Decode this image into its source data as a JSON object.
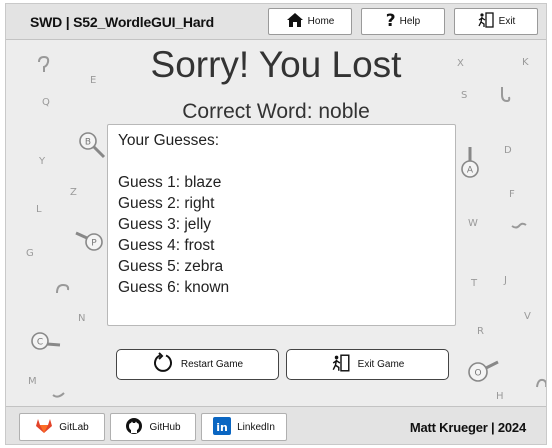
{
  "header": {
    "app_title": "SWD | S52_WordleGUI_Hard",
    "home_label": "Home",
    "help_label": "Help",
    "exit_label": "Exit"
  },
  "main": {
    "title": "Sorry! You Lost",
    "correct_word": "Correct Word: noble",
    "guesses_heading": "Your Guesses:",
    "guesses": [
      "Guess 1: blaze",
      "Guess 2: right",
      "Guess 3: jelly",
      "Guess 4: frost",
      "Guess 5: zebra",
      "Guess 6: known"
    ],
    "restart_label": "Restart Game",
    "exit_game_label": "Exit Game"
  },
  "background_letters": [
    "E",
    "Q",
    "S",
    "X",
    "K",
    "Y",
    "Z",
    "L",
    "G",
    "D",
    "F",
    "W",
    "N",
    "T",
    "J",
    "R",
    "V",
    "M",
    "H",
    "B",
    "P",
    "C",
    "A",
    "O"
  ],
  "footer": {
    "gitlab_label": "GitLab",
    "github_label": "GitHub",
    "linkedin_label": "LinkedIn",
    "copyright": "Matt Krueger | 2024"
  },
  "colors": {
    "gitlab": "#e24329",
    "linkedin": "#0a66c2",
    "header_bg": "#e3e3e3",
    "frame_bg": "#ededed"
  }
}
